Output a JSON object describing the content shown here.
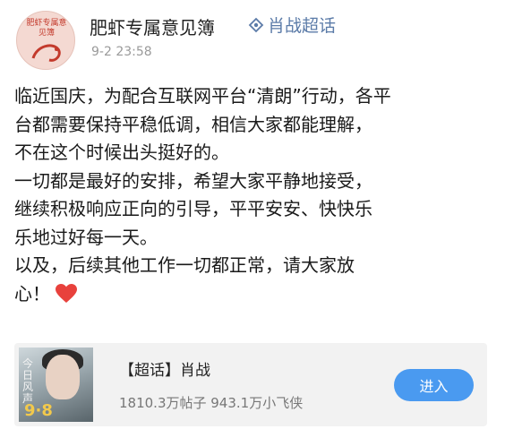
{
  "post": {
    "avatar_text": "肥虾专属意见簿",
    "username": "肥虾专属意见簿",
    "topic_link": "肖战超话",
    "timestamp": "9-2 23:58",
    "lines": [
      "临近国庆，为配合互联网平台“清朗”行动，各平",
      "台都需要保持平稳低调，相信大家都能理解，",
      "不在这个时候出头挺好的。",
      "一切都是最好的安排，希望大家平静地接受，",
      "继续积极响应正向的引导，平平安安、快快乐",
      "乐地过好每一天。",
      "以及，后续其他工作一切都正常，请大家放",
      "心！"
    ],
    "heart_icon": "red-heart-icon"
  },
  "card": {
    "title": "【超话】肖战",
    "stats": "1810.3万帖子 943.1万小飞侠",
    "enter_label": "进入",
    "poster_text": "今日风声",
    "poster_date": "9·8"
  },
  "colors": {
    "link": "#5b7ba8",
    "button": "#4a9af0",
    "heart": "#e8413c"
  }
}
